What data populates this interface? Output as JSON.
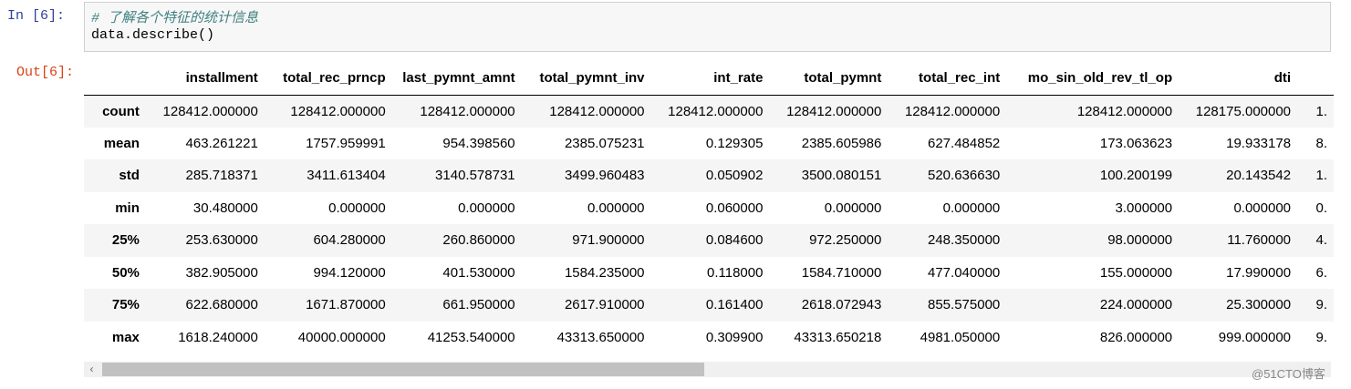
{
  "cell": {
    "in_prompt": "In  [6]:",
    "out_prompt": "Out[6]:",
    "comment": "# 了解各个特征的统计信息",
    "code": "data.describe()"
  },
  "table": {
    "columns": [
      "",
      "installment",
      "total_rec_prncp",
      "last_pymnt_amnt",
      "total_pymnt_inv",
      "int_rate",
      "total_pymnt",
      "total_rec_int",
      "mo_sin_old_rev_tl_op",
      "dti",
      ""
    ],
    "rows": [
      {
        "label": "count",
        "values": [
          "128412.000000",
          "128412.000000",
          "128412.000000",
          "128412.000000",
          "128412.000000",
          "128412.000000",
          "128412.000000",
          "128412.000000",
          "128175.000000",
          "1."
        ]
      },
      {
        "label": "mean",
        "values": [
          "463.261221",
          "1757.959991",
          "954.398560",
          "2385.075231",
          "0.129305",
          "2385.605986",
          "627.484852",
          "173.063623",
          "19.933178",
          "8."
        ]
      },
      {
        "label": "std",
        "values": [
          "285.718371",
          "3411.613404",
          "3140.578731",
          "3499.960483",
          "0.050902",
          "3500.080151",
          "520.636630",
          "100.200199",
          "20.143542",
          "1."
        ]
      },
      {
        "label": "min",
        "values": [
          "30.480000",
          "0.000000",
          "0.000000",
          "0.000000",
          "0.060000",
          "0.000000",
          "0.000000",
          "3.000000",
          "0.000000",
          "0."
        ]
      },
      {
        "label": "25%",
        "values": [
          "253.630000",
          "604.280000",
          "260.860000",
          "971.900000",
          "0.084600",
          "972.250000",
          "248.350000",
          "98.000000",
          "11.760000",
          "4."
        ]
      },
      {
        "label": "50%",
        "values": [
          "382.905000",
          "994.120000",
          "401.530000",
          "1584.235000",
          "0.118000",
          "1584.710000",
          "477.040000",
          "155.000000",
          "17.990000",
          "6."
        ]
      },
      {
        "label": "75%",
        "values": [
          "622.680000",
          "1671.870000",
          "661.950000",
          "2617.910000",
          "0.161400",
          "2618.072943",
          "855.575000",
          "224.000000",
          "25.300000",
          "9."
        ]
      },
      {
        "label": "max",
        "values": [
          "1618.240000",
          "40000.000000",
          "41253.540000",
          "43313.650000",
          "0.309900",
          "43313.650218",
          "4981.050000",
          "826.000000",
          "999.000000",
          "9."
        ]
      }
    ]
  },
  "scrollbar": {
    "left_arrow": "‹"
  },
  "watermark": "@51CTO博客"
}
